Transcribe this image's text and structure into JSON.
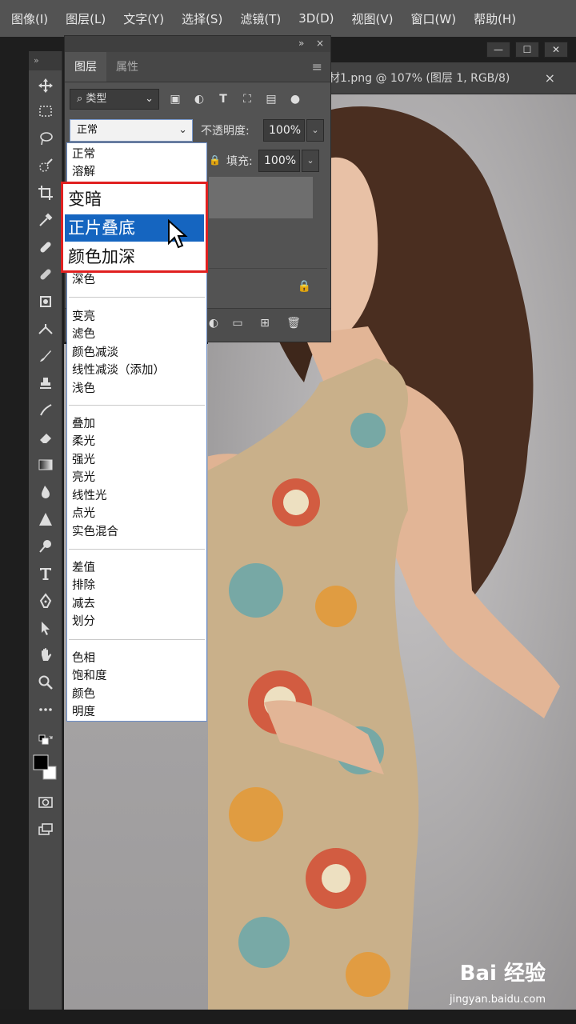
{
  "menubar": {
    "items": [
      "图像(I)",
      "图层(L)",
      "文字(Y)",
      "选择(S)",
      "滤镜(T)",
      "3D(D)",
      "视图(V)",
      "窗口(W)",
      "帮助(H)"
    ]
  },
  "window_controls": [
    "—",
    "☐",
    "✕"
  ],
  "document_tab": {
    "title": "材1.png @ 107% (图层 1, RGB/8)",
    "close": "×"
  },
  "layers_panel": {
    "top_controls": [
      "»",
      "×"
    ],
    "tabs": [
      "图层",
      "属性"
    ],
    "menu_icon": "≡",
    "filter": {
      "value": "类型",
      "icon": "search-icon"
    },
    "filter_icons": [
      "image-icon",
      "adjustment-icon",
      "type-icon",
      "shape-icon",
      "smart-object-icon",
      "toggle-icon"
    ],
    "blend_mode": "正常",
    "opacity_label": "不透明度:",
    "opacity_value": "100%",
    "fill_label": "填充:",
    "fill_value": "100%",
    "footer_icons": [
      "link-icon",
      "fx-icon",
      "mask-icon",
      "adjustment-icon",
      "folder-icon",
      "new-layer-icon",
      "trash-icon"
    ]
  },
  "blend_list": {
    "group1": [
      "正常",
      "溶解"
    ],
    "highlighted": [
      "变暗",
      "正片叠底",
      "颜色加深"
    ],
    "selected": "正片叠底",
    "group2_tail": "深色",
    "group3": [
      "变亮",
      "滤色",
      "颜色减淡",
      "线性减淡（添加）",
      "浅色"
    ],
    "group4": [
      "叠加",
      "柔光",
      "强光",
      "亮光",
      "线性光",
      "点光",
      "实色混合"
    ],
    "group5": [
      "差值",
      "排除",
      "减去",
      "划分"
    ],
    "group6": [
      "色相",
      "饱和度",
      "颜色",
      "明度"
    ]
  },
  "watermark": {
    "brand": "Bai 经验",
    "url": "jingyan.baidu.com"
  },
  "colors": {
    "highlight_border": "#e02020",
    "selection": "#1565c0",
    "panel": "#535353",
    "menubar": "#535353"
  }
}
